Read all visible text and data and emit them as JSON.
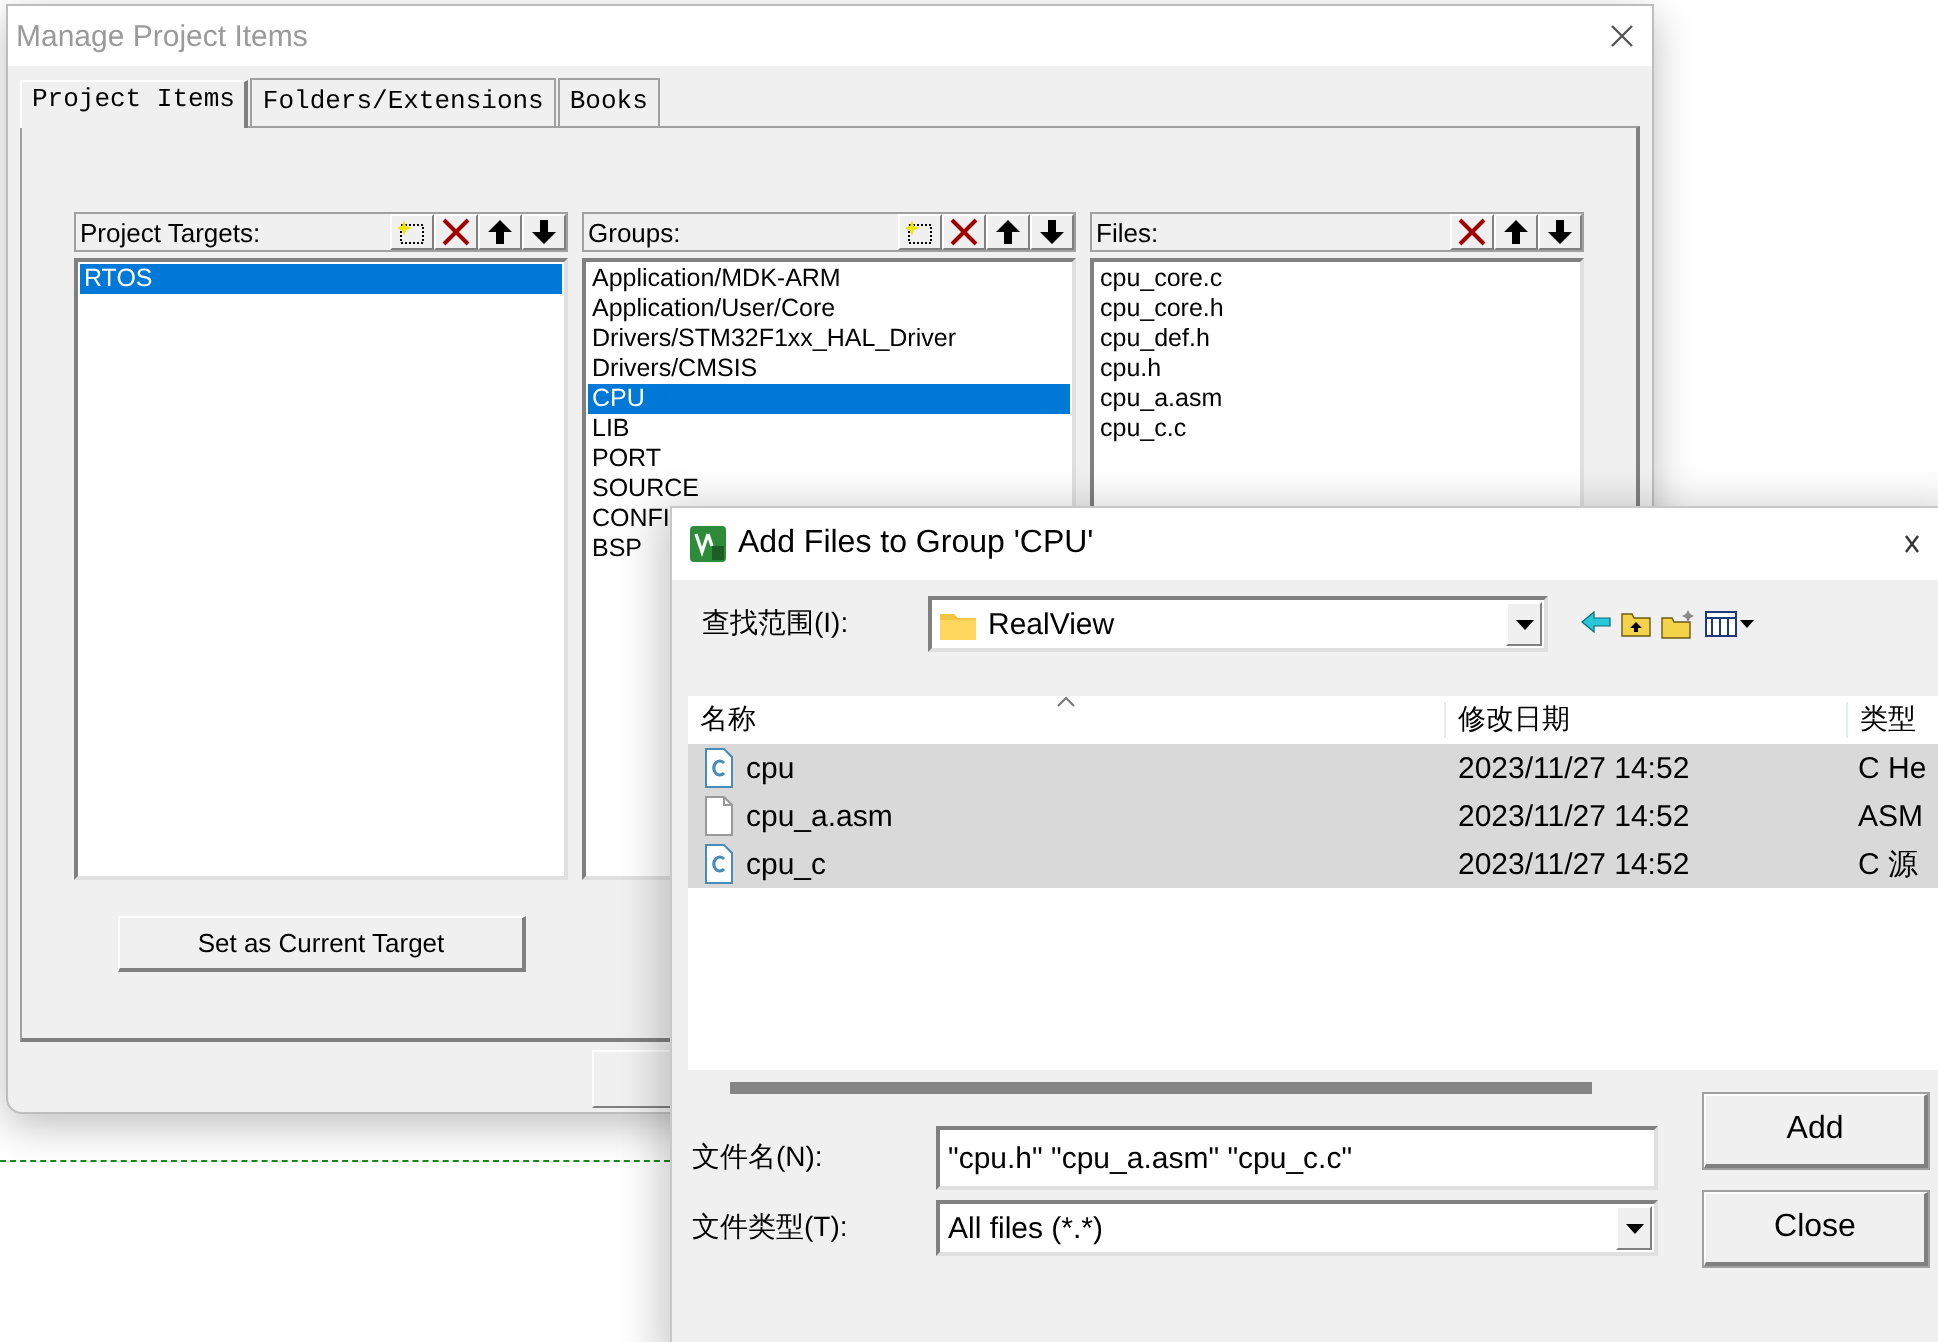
{
  "project_window": {
    "title": "Manage Project Items",
    "tabs": [
      {
        "label": "Project Items",
        "selected": true
      },
      {
        "label": "Folders/Extensions",
        "selected": false
      },
      {
        "label": "Books",
        "selected": false
      }
    ],
    "panels": [
      {
        "title": "Project Targets:",
        "tools": [
          {
            "kind": "new"
          },
          {
            "kind": "delete"
          },
          {
            "kind": "up"
          },
          {
            "kind": "down"
          }
        ],
        "items": [
          {
            "label": "RTOS",
            "selected": true
          }
        ]
      },
      {
        "title": "Groups:",
        "tools": [
          {
            "kind": "new"
          },
          {
            "kind": "delete"
          },
          {
            "kind": "up"
          },
          {
            "kind": "down"
          }
        ],
        "items": [
          {
            "label": "Application/MDK-ARM",
            "selected": false
          },
          {
            "label": "Application/User/Core",
            "selected": false
          },
          {
            "label": "Drivers/STM32F1xx_HAL_Driver",
            "selected": false
          },
          {
            "label": "Drivers/CMSIS",
            "selected": false
          },
          {
            "label": "CPU",
            "selected": true
          },
          {
            "label": "LIB",
            "selected": false
          },
          {
            "label": "PORT",
            "selected": false
          },
          {
            "label": "SOURCE",
            "selected": false
          },
          {
            "label": "CONFI",
            "selected": false
          },
          {
            "label": "BSP",
            "selected": false
          }
        ]
      },
      {
        "title": "Files:",
        "tools": [
          {
            "kind": "delete"
          },
          {
            "kind": "up"
          },
          {
            "kind": "down"
          }
        ],
        "items": [
          {
            "label": "cpu_core.c",
            "selected": false
          },
          {
            "label": "cpu_core.h",
            "selected": false
          },
          {
            "label": "cpu_def.h",
            "selected": false
          },
          {
            "label": "cpu.h",
            "selected": false
          },
          {
            "label": "cpu_a.asm",
            "selected": false
          },
          {
            "label": "cpu_c.c",
            "selected": false
          }
        ]
      }
    ],
    "target_button": "Set as Current Target"
  },
  "add_files_dialog": {
    "title": "Add Files to Group 'CPU'",
    "look_in_label": "查找范围(I):",
    "look_in_value": "RealView",
    "toolbar": [
      {
        "kind": "back"
      },
      {
        "kind": "up"
      },
      {
        "kind": "newfolder"
      },
      {
        "kind": "view"
      }
    ],
    "columns": [
      "名称",
      "修改日期",
      "类型"
    ],
    "rows": [
      {
        "kind": "source",
        "name": "cpu",
        "modified": "2023/11/27 14:52",
        "type": "C He",
        "selected": true
      },
      {
        "kind": "plain",
        "name": "cpu_a.asm",
        "modified": "2023/11/27 14:52",
        "type": "ASM",
        "selected": true
      },
      {
        "kind": "source",
        "name": "cpu_c",
        "modified": "2023/11/27 14:52",
        "type": "C 源",
        "selected": true
      }
    ],
    "file_name_label": "文件名(N):",
    "file_name_value": "\"cpu.h\" \"cpu_a.asm\" \"cpu_c.c\"",
    "file_type_label": "文件类型(T):",
    "file_type_value": "All files (*.*)",
    "buttons": [
      "Add",
      "Close"
    ]
  }
}
